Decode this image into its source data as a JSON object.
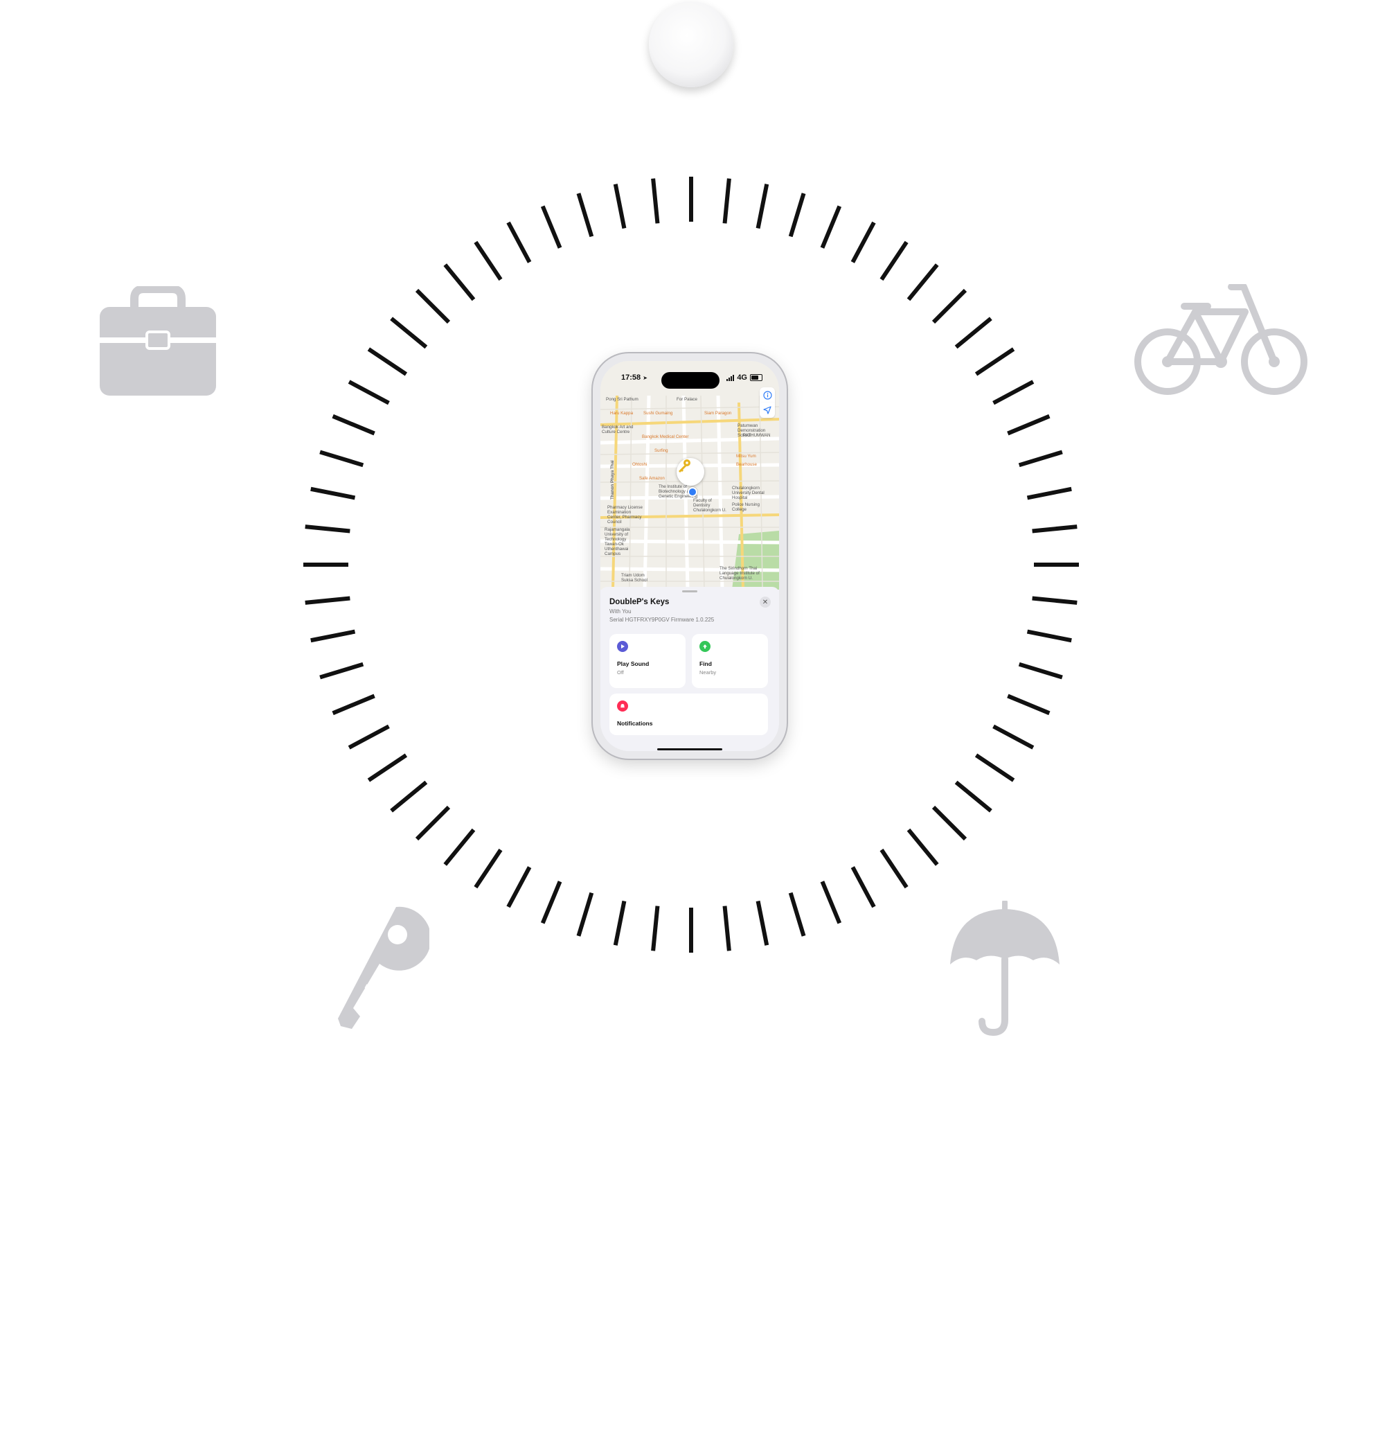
{
  "phone": {
    "status": {
      "time": "17:58",
      "network": "4G"
    },
    "map": {
      "labels": [
        {
          "text": "Pong Sri Pathum",
          "tone": "gray"
        },
        {
          "text": "For Palace",
          "tone": "gray"
        },
        {
          "text": "Haru Kappa",
          "tone": "orange"
        },
        {
          "text": "Sushi Gumaing",
          "tone": "orange"
        },
        {
          "text": "Siam Paragon",
          "tone": "orange"
        },
        {
          "text": "Bangkok Art and Culture Centre",
          "tone": "gray"
        },
        {
          "text": "Bangkok Medical Center",
          "tone": "orange"
        },
        {
          "text": "Patumwan Demonstration School",
          "tone": "gray"
        },
        {
          "text": "PATHUMWAN",
          "tone": "gray"
        },
        {
          "text": "Surfing",
          "tone": "orange"
        },
        {
          "text": "Ohtoshi",
          "tone": "orange"
        },
        {
          "text": "Safe Amazon",
          "tone": "orange"
        },
        {
          "text": "The Institute of Biotechnology and Genetic Engineering",
          "tone": "gray"
        },
        {
          "text": "Faculty of Dentistry Chulalongkorn U.",
          "tone": "gray"
        },
        {
          "text": "Chulalongkorn University Dental Hospital",
          "tone": "gray"
        },
        {
          "text": "Police Nursing College",
          "tone": "gray"
        },
        {
          "text": "Pharmacy License Examination Center, Pharmacy Council",
          "tone": "gray"
        },
        {
          "text": "Rajamangala University of Technology Tawan-Ok Uthenthawai Campus",
          "tone": "gray"
        },
        {
          "text": "Triam Udom Suksa School",
          "tone": "gray"
        },
        {
          "text": "The Sirindhorn Thai Language Institute of Chulalongkorn U.",
          "tone": "gray"
        },
        {
          "text": "Mitsu Yum",
          "tone": "orange"
        },
        {
          "text": "Bearhouse",
          "tone": "orange"
        },
        {
          "text": "Thanon Phaya Thai",
          "tone": "road"
        }
      ]
    },
    "item": {
      "title": "DoubleP's Keys",
      "subtitle": "With You",
      "serial": "Serial HGTFRXY9P0GV Firmware 1.0.225"
    },
    "actions": [
      {
        "label": "Play Sound",
        "sub": "Off",
        "color": "#5b5bd6"
      },
      {
        "label": "Find",
        "sub": "Nearby",
        "color": "#34c759"
      },
      {
        "label": "Notifications",
        "sub": "",
        "color": "#ff2d55"
      }
    ]
  },
  "surrounding_icons": [
    "airtag",
    "briefcase-icon",
    "bicycle-icon",
    "key-icon",
    "umbrella-icon"
  ],
  "colors": {
    "icon_gray": "#cdcdd1",
    "tick": "#111111"
  }
}
